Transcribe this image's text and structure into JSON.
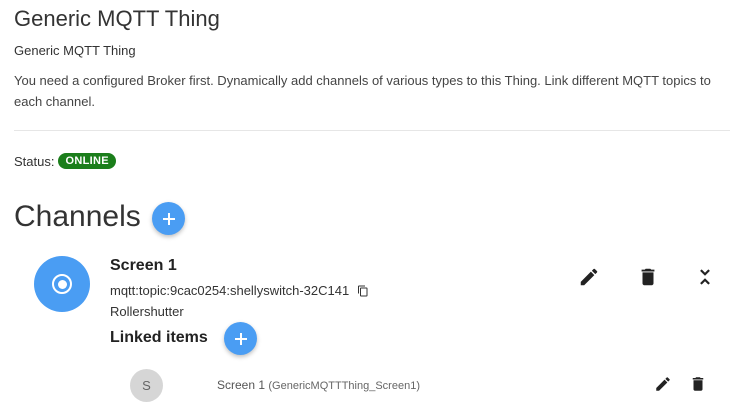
{
  "header": {
    "title": "Generic MQTT Thing",
    "subtitle": "Generic MQTT Thing",
    "description": "You need a configured Broker first. Dynamically add channels of various types to this Thing. Link different MQTT topics to each channel."
  },
  "status": {
    "label": "Status:",
    "value": "ONLINE",
    "color": "#1b7e1b"
  },
  "channels": {
    "heading": "Channels",
    "accent_color": "#4a9df3",
    "items": [
      {
        "name": "Screen 1",
        "uid": "mqtt:topic:9cac0254:shellyswitch-32C141",
        "type": "Rollershutter",
        "icon": "radio-button-icon",
        "linked_heading": "Linked items",
        "linked_items": [
          {
            "avatar_letter": "S",
            "label": "Screen 1",
            "item_name": "(GenericMQTTThing_Screen1)"
          }
        ]
      }
    ]
  }
}
